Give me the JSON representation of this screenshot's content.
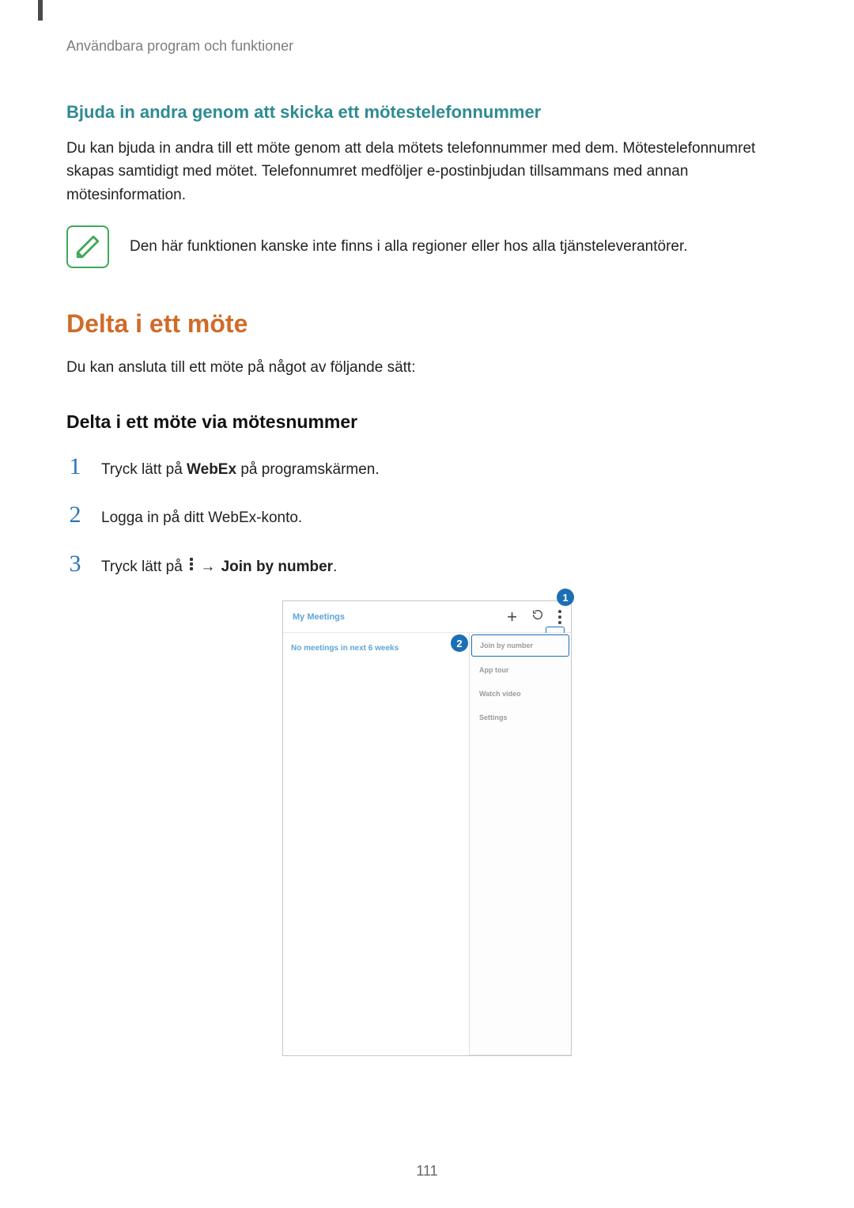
{
  "running_head": "Användbara program och funktioner",
  "section_invite": {
    "heading": "Bjuda in andra genom att skicka ett mötestelefonnummer",
    "body": "Du kan bjuda in andra till ett möte genom att dela mötets telefonnummer med dem. Mötestelefonnumret skapas samtidigt med mötet. Telefonnumret medföljer e-postinbjudan tillsammans med annan mötesinformation.",
    "note": "Den här funktionen kanske inte finns i alla regioner eller hos alla tjänsteleverantörer."
  },
  "section_join": {
    "heading": "Delta i ett möte",
    "intro": "Du kan ansluta till ett möte på något av följande sätt:",
    "sub_heading": "Delta i ett möte via mötesnummer",
    "steps": {
      "s1": {
        "num": "1",
        "pre": "Tryck lätt på ",
        "bold": "WebEx",
        "post": " på programskärmen."
      },
      "s2": {
        "num": "2",
        "text": "Logga in på ditt WebEx-konto."
      },
      "s3": {
        "num": "3",
        "pre": "Tryck lätt på ",
        "arrow": "→",
        "bold": "Join by number",
        "post": "."
      }
    }
  },
  "device": {
    "title": "My Meetings",
    "empty_state": "No meetings in next 6 weeks",
    "menu": {
      "join_by_number": "Join by number",
      "app_tour": "App tour",
      "watch_video": "Watch video",
      "settings": "Settings"
    }
  },
  "callouts": {
    "c1": "1",
    "c2": "2"
  },
  "page_number": "111"
}
